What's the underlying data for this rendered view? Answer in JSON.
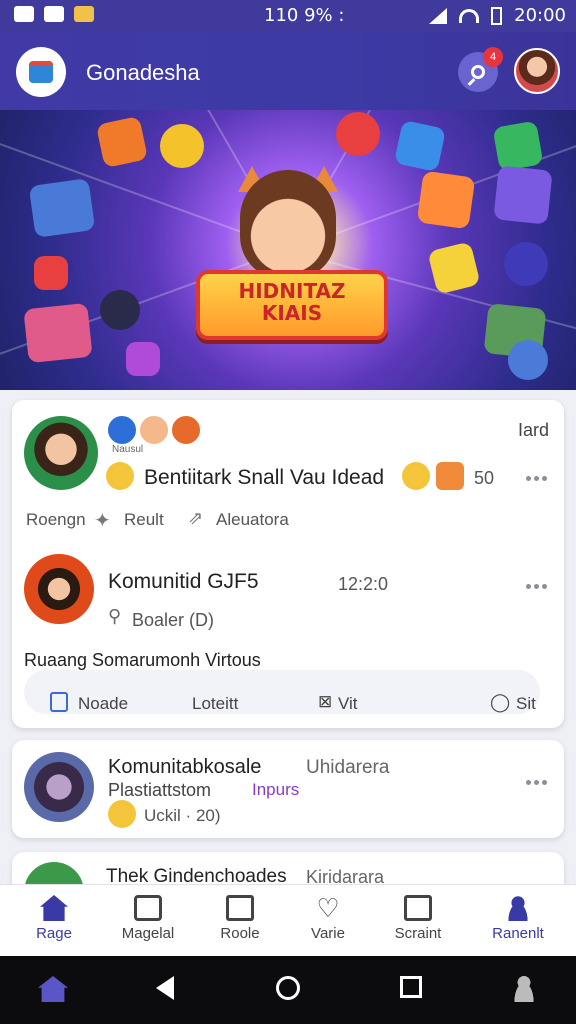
{
  "status_bar": {
    "center": "110 9% :",
    "time": "20:00"
  },
  "app_bar": {
    "title": "Gonadesha",
    "notification_count": "4"
  },
  "banner": {
    "title_line1": "HIDNITAZ",
    "title_line2": "KIAIS"
  },
  "post1": {
    "reaction_sub": "Nausul",
    "tag": "Iard",
    "text": "Bentiitark Snall Vau Idead",
    "count": "50",
    "actions": [
      "Roengn",
      "Reult",
      "Aleuatora"
    ]
  },
  "post2": {
    "title": "Komunitid GJF5",
    "time": "12:2:0",
    "sub": "Boaler (D)",
    "caption": "Ruaang Somarumonh Virtous",
    "actions": [
      "Noade",
      "Loteitt",
      "Vit",
      "Sit"
    ]
  },
  "post3": {
    "title": "Komunitabkosale",
    "title_suffix": "Uhidarera",
    "line2": "Plastiattstom",
    "line2_accent": "Inpurs",
    "sub": "Uckil · 20)"
  },
  "post4": {
    "title": "Thek Gindenchoades",
    "suffix": "Kiridarara"
  },
  "bottom_nav": [
    {
      "label": "Rage",
      "icon": "home-icon"
    },
    {
      "label": "Magelal",
      "icon": "store-icon"
    },
    {
      "label": "Roole",
      "icon": "mail-icon"
    },
    {
      "label": "Varie",
      "icon": "heart-icon"
    },
    {
      "label": "Scraint",
      "icon": "screen-icon"
    },
    {
      "label": "Ranenlt",
      "icon": "person-icon"
    }
  ],
  "colors": {
    "primary": "#3d3aa5",
    "accent": "#e8343f",
    "active_nav": "#3a3aa6"
  }
}
